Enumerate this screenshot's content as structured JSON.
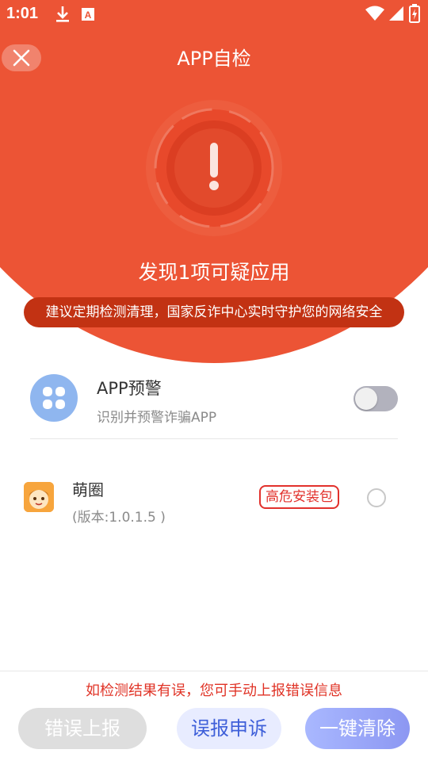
{
  "status_bar": {
    "time": "1:01",
    "icons": [
      "download-icon",
      "a-notification-icon",
      "wifi-icon",
      "signal-icon",
      "battery-icon"
    ]
  },
  "header": {
    "title": "APP自检",
    "close_icon": "close-icon"
  },
  "scan_result": {
    "headline": "发现1项可疑应用",
    "tip": "建议定期检测清理，国家反诈中心实时守护您的网络安全",
    "status_icon": "exclamation-alert-icon"
  },
  "app_warning": {
    "title": "APP预警",
    "subtitle": "识别并预警诈骗APP",
    "icon": "four-leaf-icon",
    "enabled": false
  },
  "suspicious_apps": [
    {
      "name": "萌圈",
      "version": "(版本:1.0.1.5 )",
      "risk_label": "高危安装包",
      "selected": false
    }
  ],
  "footer": {
    "note": "如检测结果有误，您可手动上报错误信息",
    "report_label": "错误上报",
    "appeal_label": "误报申诉",
    "clean_label": "一键清除"
  },
  "colors": {
    "primary_red": "#ec5435",
    "pill_red": "#c23213",
    "danger": "#e2312c",
    "accent_blue": "#3e5fd9"
  }
}
